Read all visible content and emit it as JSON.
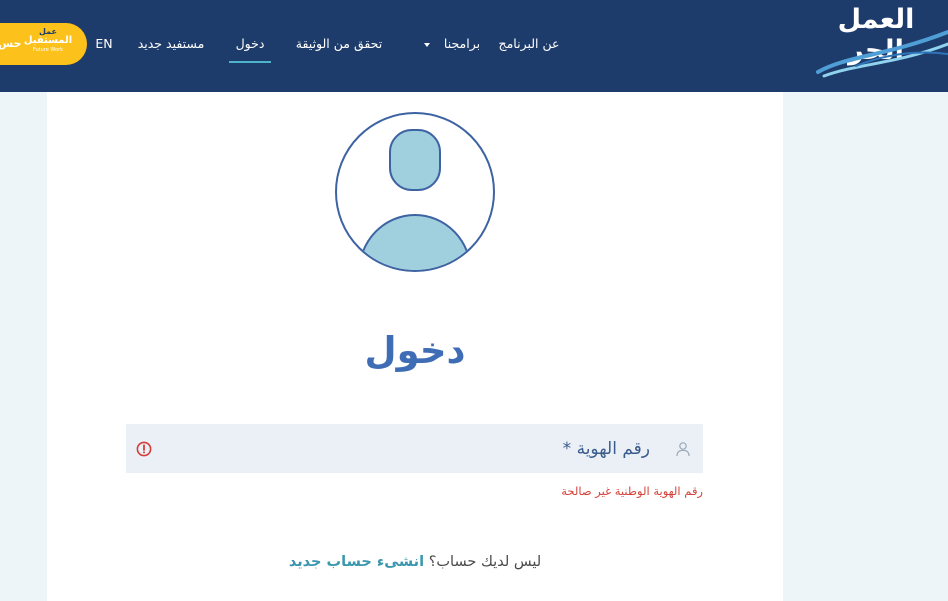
{
  "header": {
    "brand_logo": {
      "line1": "العمل",
      "line2": "الحر"
    },
    "nav": [
      {
        "label": "عن البرنامج"
      },
      {
        "label": "برامجنا",
        "has_dropdown": true
      },
      {
        "label": "تحقق من الوثيقة"
      },
      {
        "label": "دخول",
        "active": true
      },
      {
        "label": "مستفيد جديد"
      }
    ],
    "language_toggle": "EN",
    "account_pill": {
      "label": "حس",
      "logo_text": [
        "عمل",
        "المستقبل",
        "Future Work"
      ]
    }
  },
  "login": {
    "title": "دخول",
    "id_field": {
      "label": "رقم الهوية *",
      "value": "",
      "error": "رقم الهوية الوطنية غير صالحة"
    },
    "signup_prompt": "ليس لديك حساب؟",
    "signup_link": "انشىء حساب جديد"
  },
  "icons": {
    "nav_dropdown": "chevron-down-icon",
    "id_field": "user-icon",
    "id_field_status": "error-icon",
    "avatar": "avatar-placeholder-icon"
  },
  "colors": {
    "header_bg": "#1e3c6b",
    "nav_active_underline": "#4bb4cb",
    "account_pill_bg": "#fcc21b",
    "page_bg": "#eef5f8",
    "card_bg": "#ffffff",
    "title": "#3f6db5",
    "input_bg": "#eaf0f6",
    "error": "#d4433b",
    "link": "#3a97ad",
    "avatar_fill": "#a0d0de",
    "avatar_stroke": "#3e63a3"
  }
}
